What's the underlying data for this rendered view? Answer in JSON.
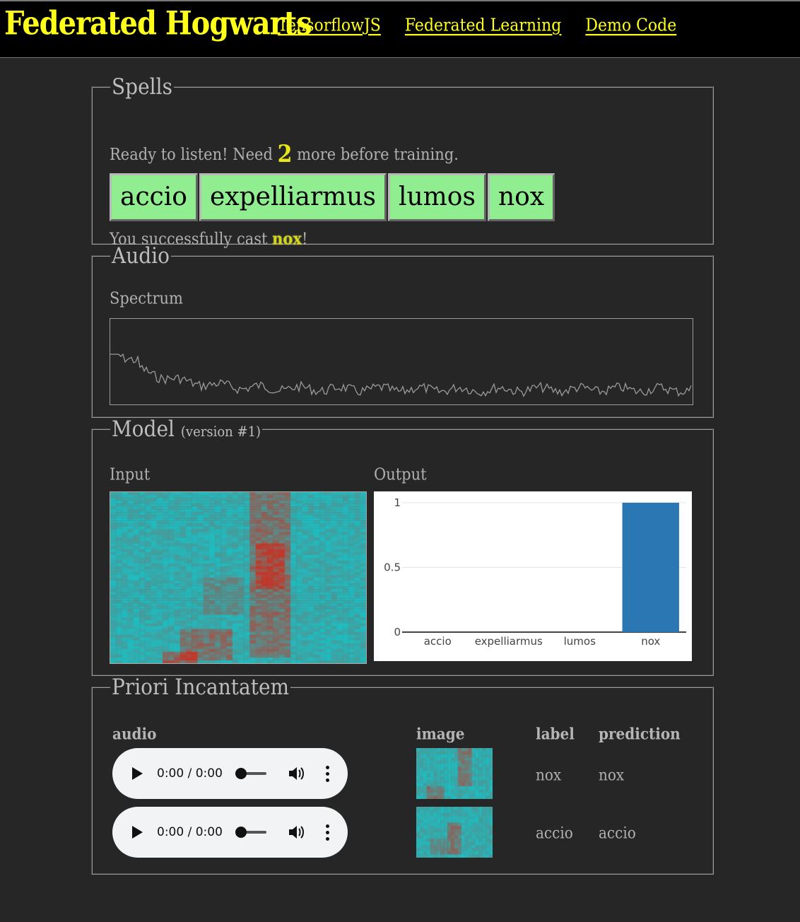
{
  "header": {
    "brand": "Federated Hogwarts",
    "nav": [
      "TensorflowJS",
      "Federated Learning",
      "Demo Code"
    ]
  },
  "spells": {
    "legend": "Spells",
    "status_prefix": "Ready to listen! Need",
    "need_count": "2",
    "status_suffix": "more before training.",
    "buttons": [
      "accio",
      "expelliarmus",
      "lumos",
      "nox"
    ],
    "cast_prefix": "You successfully cast",
    "cast_word": "nox",
    "cast_suffix": "!"
  },
  "audio": {
    "legend": "Audio",
    "spectrum_label": "Spectrum"
  },
  "model": {
    "legend": "Model",
    "version": "(version #1)",
    "input_label": "Input",
    "output_label": "Output"
  },
  "chart_data": {
    "type": "bar",
    "categories": [
      "accio",
      "expelliarmus",
      "lumos",
      "nox"
    ],
    "values": [
      0,
      0,
      0,
      1
    ],
    "ylim": [
      0,
      1
    ],
    "yticks": [
      "0",
      "0.5",
      "1"
    ],
    "bar_color": "#2a77b4",
    "grid": true
  },
  "priori": {
    "legend": "Priori Incantatem",
    "headers": {
      "audio": "audio",
      "image": "image",
      "label": "label",
      "prediction": "prediction"
    },
    "rows": [
      {
        "time": "0:00 / 0:00",
        "label": "nox",
        "prediction": "nox"
      },
      {
        "time": "0:00 / 0:00",
        "label": "accio",
        "prediction": "accio"
      }
    ]
  },
  "colors": {
    "background": "#262626",
    "brand_yellow": "#ffff1a",
    "spell_button": "#90ee90",
    "spectrogram_base": "#1fbcc0",
    "spectrogram_hot": "#c0392b"
  }
}
